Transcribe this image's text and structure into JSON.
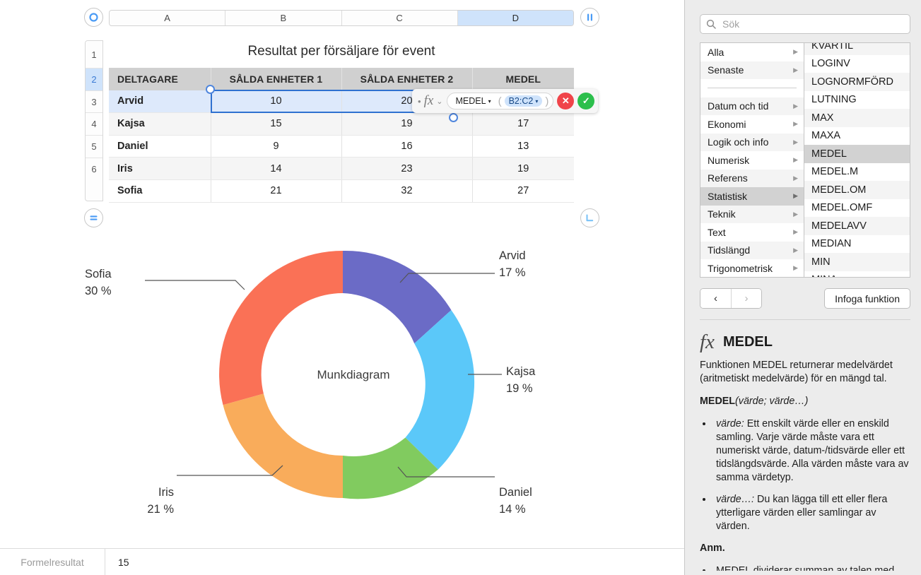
{
  "canvas": {
    "columns": [
      {
        "label": "A",
        "selected": false
      },
      {
        "label": "B",
        "selected": false
      },
      {
        "label": "C",
        "selected": false
      },
      {
        "label": "D",
        "selected": true
      }
    ],
    "row_numbers": [
      "1",
      "2",
      "3",
      "4",
      "5",
      "6"
    ],
    "table": {
      "title": "Resultat per försäljare för event",
      "headers": [
        "DELTAGARE",
        "SÅLDA ENHETER 1",
        "SÅLDA ENHETER 2",
        "MEDEL"
      ],
      "rows": [
        {
          "name": "Arvid",
          "sold1": "10",
          "sold2": "20",
          "medel": "",
          "selected": true
        },
        {
          "name": "Kajsa",
          "sold1": "15",
          "sold2": "19",
          "medel": "17",
          "selected": false
        },
        {
          "name": "Daniel",
          "sold1": "9",
          "sold2": "16",
          "medel": "13",
          "selected": false
        },
        {
          "name": "Iris",
          "sold1": "14",
          "sold2": "23",
          "medel": "19",
          "selected": false
        },
        {
          "name": "Sofia",
          "sold1": "21",
          "sold2": "32",
          "medel": "27",
          "selected": false
        }
      ]
    },
    "formula_editor": {
      "fx_label": "fx",
      "bullet": "•",
      "chevron": "⌄",
      "function_token": "MEDEL",
      "range_token": "B2:C2",
      "caret": "▾",
      "open_paren": "(",
      "close_paren": ")",
      "cancel_label": "✕",
      "accept_label": "✓"
    },
    "handles": {
      "top_left": "table-select-handle",
      "top_right": "column-resize-handle",
      "bottom_left": "row-resize-handle",
      "bottom_right": "table-resize-handle"
    }
  },
  "chart_data": {
    "type": "pie",
    "variant": "donut",
    "title": "Munkdiagram",
    "center_label": "Munkdiagram",
    "categories": [
      "Arvid",
      "Kajsa",
      "Daniel",
      "Iris",
      "Sofia"
    ],
    "values": [
      17,
      19,
      14,
      21,
      30
    ],
    "value_suffix": "%",
    "labels": [
      {
        "name": "Arvid",
        "value": "17 %"
      },
      {
        "name": "Kajsa",
        "value": "19 %"
      },
      {
        "name": "Daniel",
        "value": "14 %"
      },
      {
        "name": "Iris",
        "value": "21 %"
      },
      {
        "name": "Sofia",
        "value": "30 %"
      }
    ],
    "colors": [
      "#6B6BC6",
      "#5BC8F9",
      "#81CB5F",
      "#F9AC5B",
      "#FA7156"
    ],
    "legend": "labels-with-leader-lines",
    "grid": false
  },
  "bottom_bar": {
    "label": "Formelresultat",
    "value": "15"
  },
  "panel": {
    "search": {
      "placeholder": "Sök",
      "value": ""
    },
    "categories": [
      {
        "label": "Alla",
        "arrow": "▶",
        "active": false
      },
      {
        "label": "Senaste",
        "arrow": "▶",
        "active": false
      },
      {
        "label": "__separator__",
        "arrow": "",
        "active": false
      },
      {
        "label": "Datum och tid",
        "arrow": "▶",
        "active": false
      },
      {
        "label": "Ekonomi",
        "arrow": "▶",
        "active": false
      },
      {
        "label": "Logik och info",
        "arrow": "▶",
        "active": false
      },
      {
        "label": "Numerisk",
        "arrow": "▶",
        "active": false
      },
      {
        "label": "Referens",
        "arrow": "▶",
        "active": false
      },
      {
        "label": "Statistisk",
        "arrow": "▶",
        "active": true
      },
      {
        "label": "Teknik",
        "arrow": "▶",
        "active": false
      },
      {
        "label": "Text",
        "arrow": "▶",
        "active": false
      },
      {
        "label": "Tidslängd",
        "arrow": "▶",
        "active": false
      },
      {
        "label": "Trigonometrisk",
        "arrow": "▶",
        "active": false
      }
    ],
    "functions": [
      {
        "label": "KVARTIL",
        "active": false
      },
      {
        "label": "LOGINV",
        "active": false
      },
      {
        "label": "LOGNORMFÖRD",
        "active": false
      },
      {
        "label": "LUTNING",
        "active": false
      },
      {
        "label": "MAX",
        "active": false
      },
      {
        "label": "MAXA",
        "active": false
      },
      {
        "label": "MEDEL",
        "active": true
      },
      {
        "label": "MEDEL.M",
        "active": false
      },
      {
        "label": "MEDEL.OM",
        "active": false
      },
      {
        "label": "MEDEL.OMF",
        "active": false
      },
      {
        "label": "MEDELAVV",
        "active": false
      },
      {
        "label": "MEDIAN",
        "active": false
      },
      {
        "label": "MIN",
        "active": false
      },
      {
        "label": "MINA",
        "active": false
      }
    ],
    "nav": {
      "back_label": "‹",
      "forward_label": "›",
      "insert_label": "Infoga funktion"
    },
    "doc": {
      "fx_glyph": "fx",
      "title": "MEDEL",
      "summary": "Funktionen MEDEL returnerar medelvärdet (aritmetiskt medelvärde) för en mängd tal.",
      "signature_name": "MEDEL",
      "signature_args": "(värde; värde…)",
      "bullets": [
        {
          "term": "värde:",
          "text": " Ett enskilt värde eller en enskild samling. Varje värde måste vara ett numeriskt värde, datum-/tidsvärde eller ett tidslängdsvärde. Alla värden måste vara av samma värdetyp."
        },
        {
          "term": "värde…:",
          "text": " Du kan lägga till ett eller flera ytterligare värden eller samlingar av värden."
        }
      ],
      "notes_heading": "Anm.",
      "notes": [
        {
          "term": "",
          "text": "MEDEL dividerar summan av talen med"
        }
      ]
    }
  }
}
